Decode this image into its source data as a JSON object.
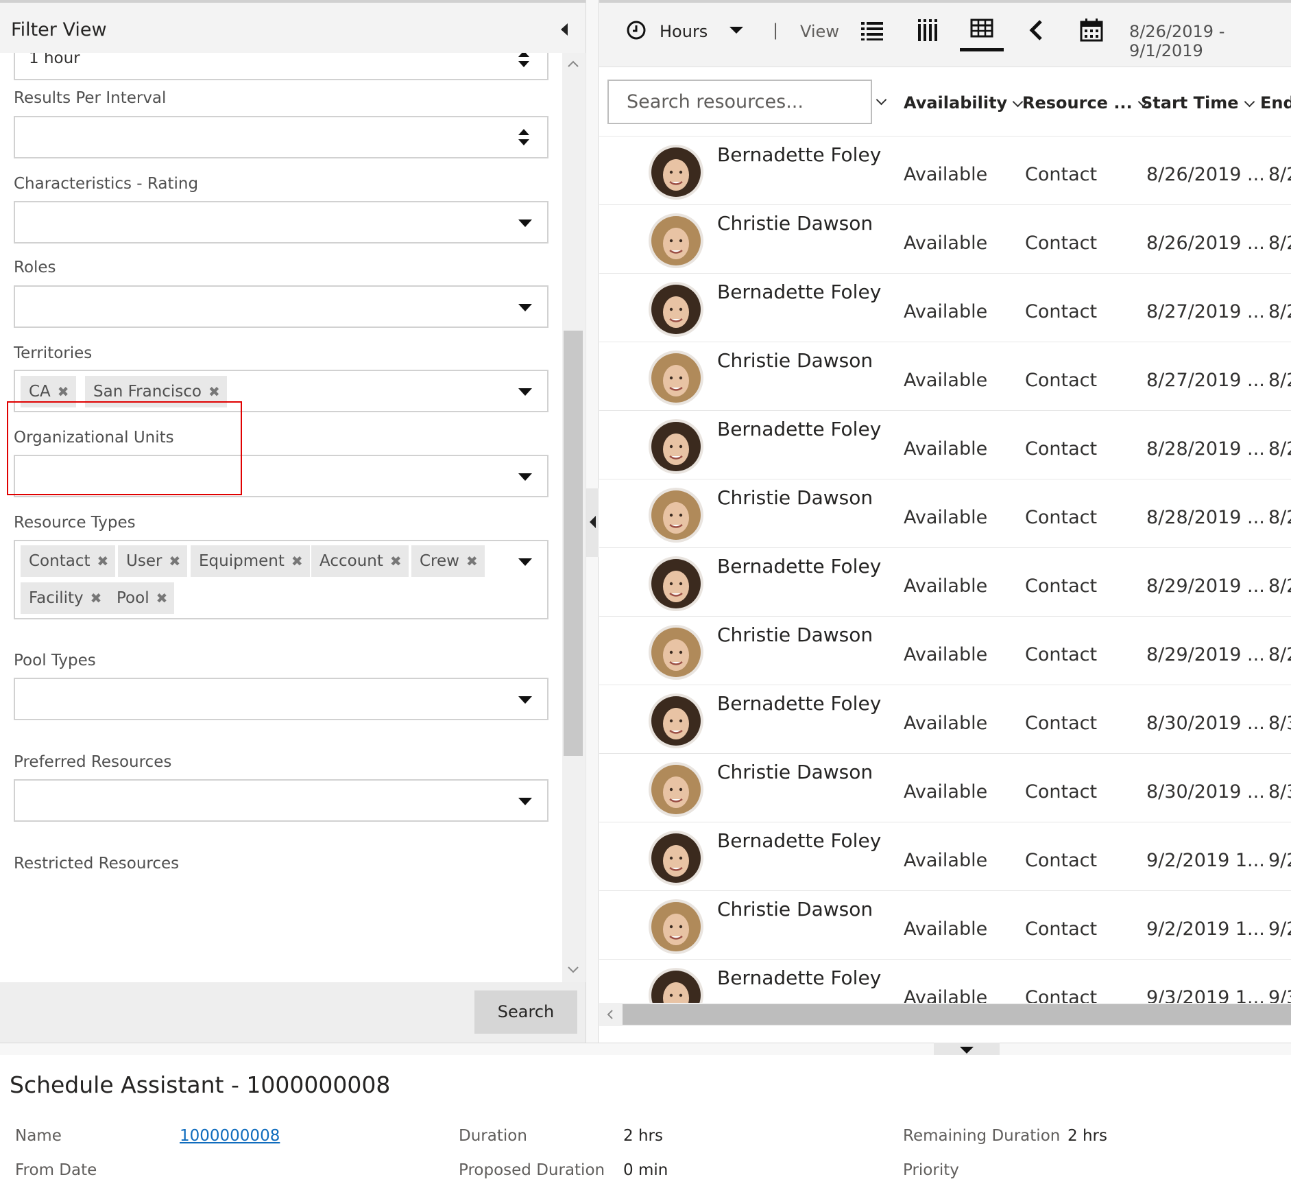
{
  "filter_panel": {
    "title": "Filter View",
    "first_field_value": "1 hour",
    "fields": {
      "results_per_interval": "Results Per Interval",
      "characteristics_rating": "Characteristics - Rating",
      "roles": "Roles",
      "territories": "Territories",
      "organizational_units": "Organizational Units",
      "resource_types": "Resource Types",
      "pool_types": "Pool Types",
      "preferred_resources": "Preferred Resources",
      "restricted_resources": "Restricted Resources"
    },
    "territory_tags": [
      "CA",
      "San Francisco"
    ],
    "resource_type_tags": [
      "Contact",
      "User",
      "Equipment",
      "Account",
      "Crew",
      "Facility",
      "Pool"
    ],
    "tag_remove_glyph": "✖",
    "search_button": "Search"
  },
  "toolbar": {
    "hours_label": "Hours",
    "separator": "|",
    "view_label": "View",
    "date_range": "8/26/2019 - 9/1/2019",
    "icons": [
      "clock-icon",
      "dropdown-caret-icon",
      "list-view-icon",
      "vertical-bars-view-icon",
      "grid-view-icon",
      "previous-arrow-icon",
      "calendar-icon"
    ]
  },
  "grid": {
    "search_placeholder": "Search resources...",
    "columns": [
      "Availability",
      "Resource ...",
      "Start Time",
      "End"
    ],
    "rows": [
      {
        "name": "Bernadette Foley",
        "availability": "Available",
        "resource_type": "Contact",
        "start": "8/26/2019 ...",
        "end": "8/2"
      },
      {
        "name": "Christie Dawson",
        "availability": "Available",
        "resource_type": "Contact",
        "start": "8/26/2019 ...",
        "end": "8/2"
      },
      {
        "name": "Bernadette Foley",
        "availability": "Available",
        "resource_type": "Contact",
        "start": "8/27/2019 ...",
        "end": "8/2"
      },
      {
        "name": "Christie Dawson",
        "availability": "Available",
        "resource_type": "Contact",
        "start": "8/27/2019 ...",
        "end": "8/2"
      },
      {
        "name": "Bernadette Foley",
        "availability": "Available",
        "resource_type": "Contact",
        "start": "8/28/2019 ...",
        "end": "8/2"
      },
      {
        "name": "Christie Dawson",
        "availability": "Available",
        "resource_type": "Contact",
        "start": "8/28/2019 ...",
        "end": "8/2"
      },
      {
        "name": "Bernadette Foley",
        "availability": "Available",
        "resource_type": "Contact",
        "start": "8/29/2019 ...",
        "end": "8/2"
      },
      {
        "name": "Christie Dawson",
        "availability": "Available",
        "resource_type": "Contact",
        "start": "8/29/2019 ...",
        "end": "8/2"
      },
      {
        "name": "Bernadette Foley",
        "availability": "Available",
        "resource_type": "Contact",
        "start": "8/30/2019 ...",
        "end": "8/3"
      },
      {
        "name": "Christie Dawson",
        "availability": "Available",
        "resource_type": "Contact",
        "start": "8/30/2019 ...",
        "end": "8/3"
      },
      {
        "name": "Bernadette Foley",
        "availability": "Available",
        "resource_type": "Contact",
        "start": "9/2/2019 1...",
        "end": "9/2"
      },
      {
        "name": "Christie Dawson",
        "availability": "Available",
        "resource_type": "Contact",
        "start": "9/2/2019 1...",
        "end": "9/2"
      },
      {
        "name": "Bernadette Foley",
        "availability": "Available",
        "resource_type": "Contact",
        "start": "9/3/2019 1...",
        "end": "9/3"
      }
    ]
  },
  "schedule_assistant": {
    "title": "Schedule Assistant - 1000000008",
    "name_label": "Name",
    "name_value": "1000000008",
    "from_date_label": "From Date",
    "duration_label": "Duration",
    "duration_value": "2 hrs",
    "proposed_duration_label": "Proposed Duration",
    "proposed_duration_value": "0 min",
    "remaining_duration_label": "Remaining Duration",
    "remaining_duration_value": "2 hrs",
    "priority_label": "Priority"
  },
  "colors": {
    "highlight_border": "#e00000",
    "link": "#0f6cbd",
    "tag_bg": "#e8e8e8"
  }
}
